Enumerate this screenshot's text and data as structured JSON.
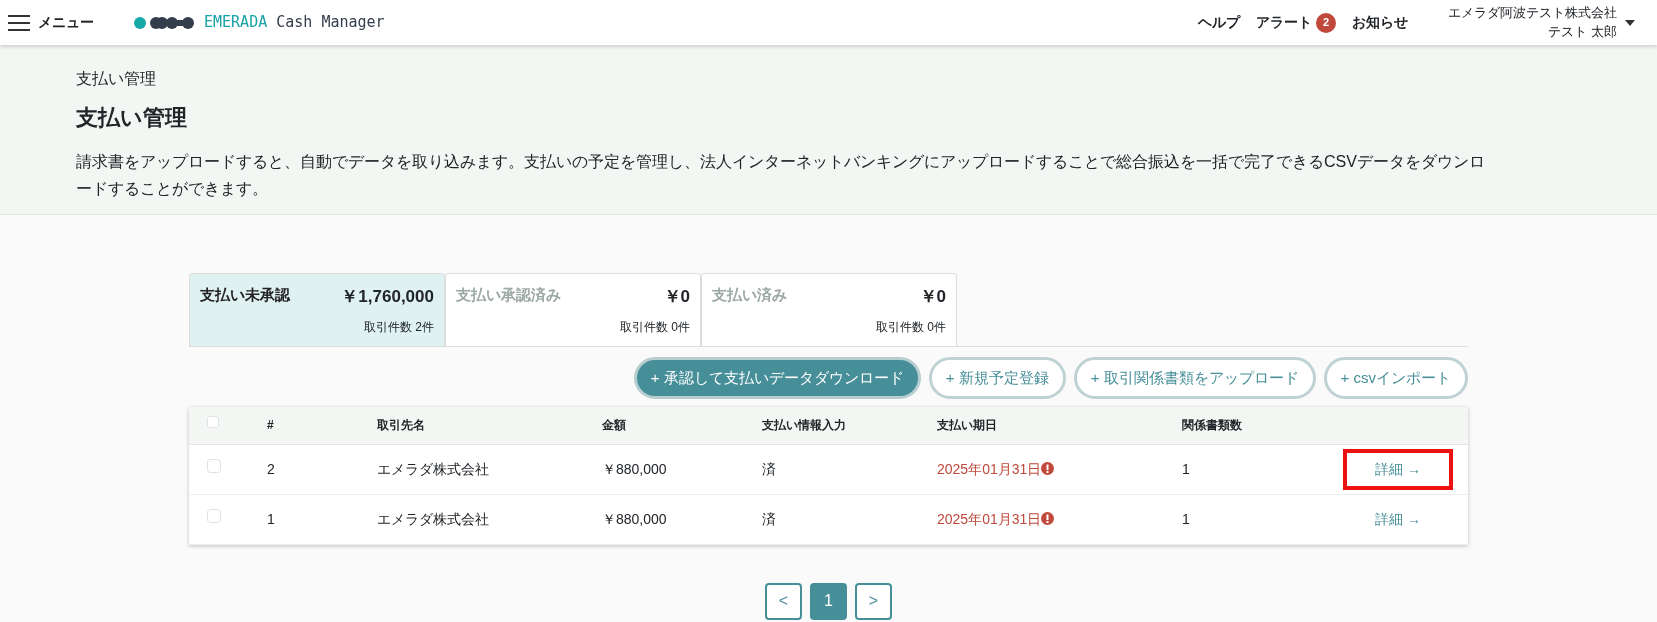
{
  "header": {
    "menu_label": "メニュー",
    "brand": {
      "name_accent": "EMERADA",
      "name_rest": "Cash Manager"
    },
    "links": [
      {
        "label": "ヘルプ"
      },
      {
        "label": "アラート",
        "badge": "2"
      },
      {
        "label": "お知らせ"
      }
    ],
    "user": {
      "company": "エメラダ阿波テスト株式会社",
      "name": "テスト 太郎"
    }
  },
  "page": {
    "breadcrumb": "支払い管理",
    "title": "支払い管理",
    "description": "請求書をアップロードすると、自動でデータを取り込みます。支払いの予定を管理し、法人インターネットバンキングにアップロードすることで総合振込を一括で完了できるCSVデータをダウンロードすることができます。"
  },
  "tabs": [
    {
      "label": "支払い未承認",
      "amount": "￥1,760,000",
      "count": "取引件数 2件",
      "selected": true
    },
    {
      "label": "支払い承認済み",
      "amount": "￥0",
      "count": "取引件数 0件",
      "selected": false
    },
    {
      "label": "支払い済み",
      "amount": "￥0",
      "count": "取引件数 0件",
      "selected": false
    }
  ],
  "actions": [
    {
      "label": "+ 承認して支払いデータダウンロード",
      "kind": "primary"
    },
    {
      "label": "+ 新規予定登録",
      "kind": "outline"
    },
    {
      "label": "+ 取引関係書類をアップロード",
      "kind": "outline"
    },
    {
      "label": "+ csvインポート",
      "kind": "outline"
    }
  ],
  "table": {
    "select_all": {
      "checked": false
    },
    "columns": [
      "#",
      "取引先名",
      "金額",
      "支払い情報入力",
      "支払い期日",
      "関係書類数"
    ],
    "rows": [
      {
        "checked": false,
        "no": "2",
        "partner": "エメラダ株式会社",
        "amount": "￥880,000",
        "info": "済",
        "due": "2025年01月31日",
        "overdue": true,
        "docs": "1",
        "link": "詳細 →",
        "highlighted": true
      },
      {
        "checked": false,
        "no": "1",
        "partner": "エメラダ株式会社",
        "amount": "￥880,000",
        "info": "済",
        "due": "2025年01月31日",
        "overdue": true,
        "docs": "1",
        "link": "詳細 →",
        "highlighted": false
      }
    ]
  },
  "pagination": {
    "prev": "<",
    "pages": [
      {
        "label": "1",
        "selected": true
      }
    ],
    "next": ">"
  }
}
